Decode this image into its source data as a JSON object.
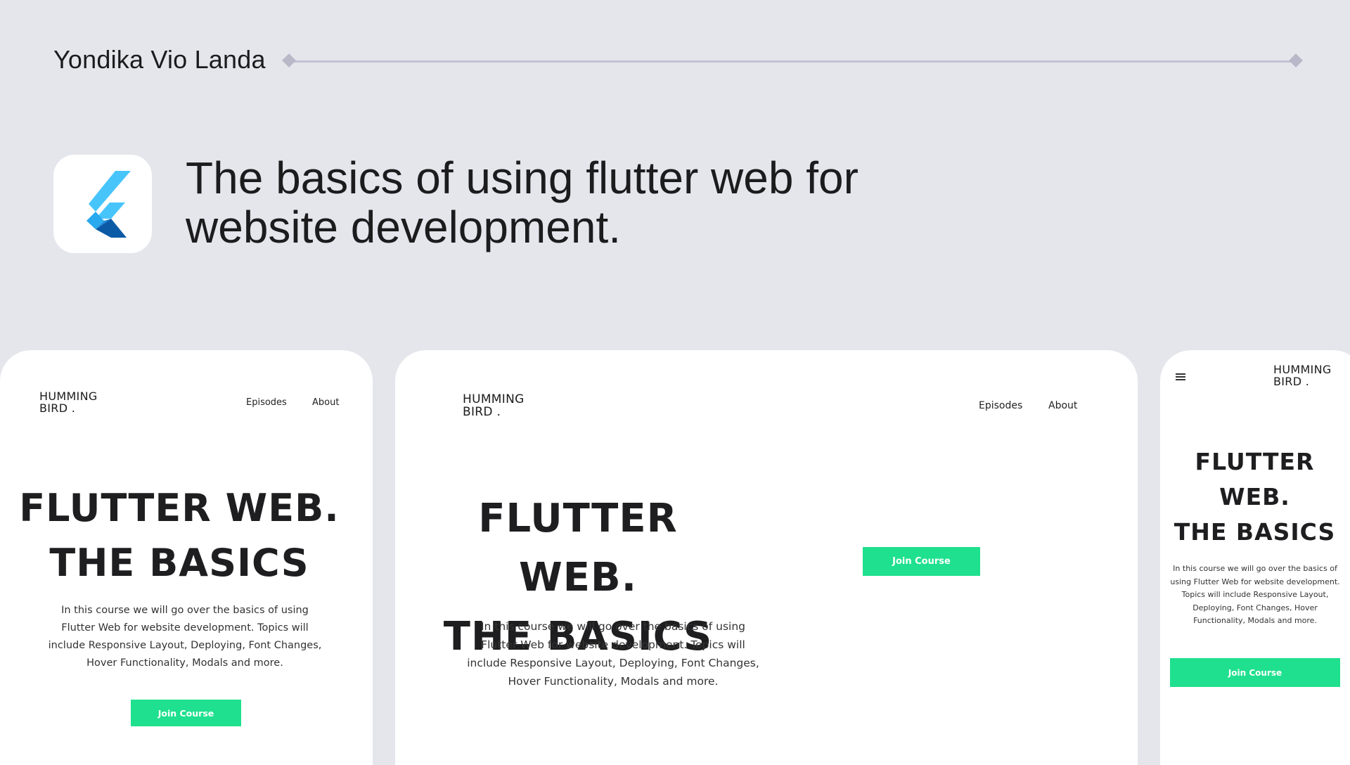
{
  "header": {
    "author": "Yondika Vio Landa",
    "title_line1": "The basics of using flutter web for",
    "title_line2": "website development.",
    "app_icon": "flutter-logo-icon"
  },
  "colors": {
    "background": "#e5e6ec",
    "accent": "#1fe08e",
    "rule": "#c2c3d2",
    "flutter_light": "#47c5fb",
    "flutter_dark": "#0b5aa5"
  },
  "site": {
    "brand_line1": "HUMMING",
    "brand_line2": "BIRD .",
    "nav_episodes": "Episodes",
    "nav_about": "About",
    "hero_line1": "FLUTTER WEB.",
    "hero_line2": "THE BASICS",
    "mobile_hero_line1": "FLUTTER",
    "mobile_hero_line2": "WEB.",
    "mobile_hero_line3": "THE BASICS",
    "description": "In this course we will go over the basics of using Flutter Web for website development. Topics will include Responsive Layout, Deploying, Font Changes, Hover Functionality, Modals and more.",
    "cta": "Join Course",
    "menu_icon": "hamburger-menu-icon"
  }
}
